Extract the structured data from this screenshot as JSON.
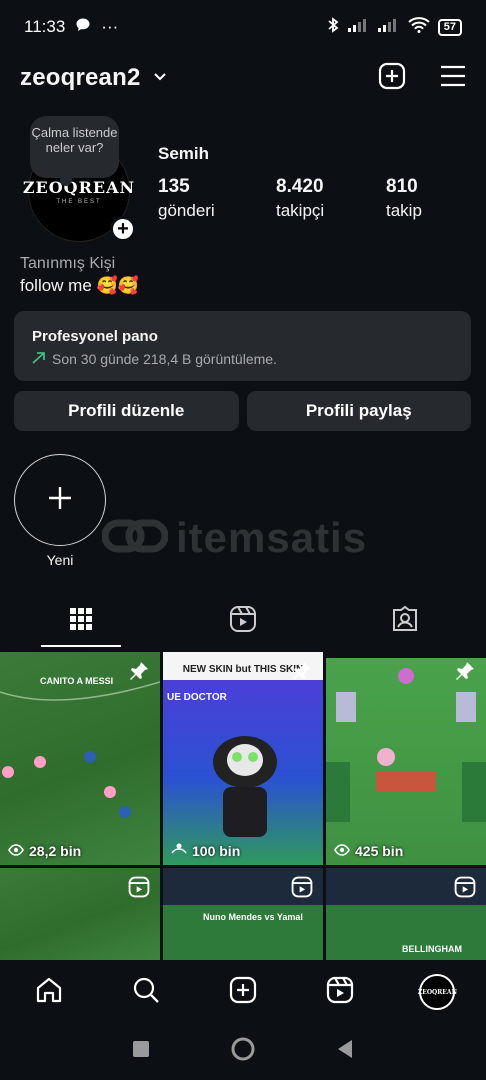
{
  "status_bar": {
    "time": "11:33",
    "dots": "···",
    "battery": "57"
  },
  "header": {
    "username": "zeoqrean2"
  },
  "profile": {
    "note": "Çalma listende neler var?",
    "avatar_logo": "ZEOQREAN",
    "avatar_sub": "THE BEST",
    "display_name": "Semih",
    "stats": [
      {
        "value": "135",
        "label": "gönderi"
      },
      {
        "value": "8.420",
        "label": "takipçi"
      },
      {
        "value": "810",
        "label": "takip"
      }
    ],
    "category": "Tanınmış Kişi",
    "bio": "follow me 🥰🥰"
  },
  "pro_panel": {
    "title": "Profesyonel pano",
    "subtitle": "Son 30 günde 218,4 B görüntüleme."
  },
  "buttons": {
    "edit": "Profili düzenle",
    "share": "Profili paylaş"
  },
  "highlight": {
    "label": "Yeni"
  },
  "watermark": {
    "text": "itemsatis"
  },
  "grid": {
    "tiles": [
      {
        "views": "28,2 bin",
        "caption": "CANITO A MESSI"
      },
      {
        "views": "100 bin",
        "caption": "NEW SKIN but THIS SKIN",
        "caption2": "UE DOCTOR"
      },
      {
        "views": "425 bin"
      },
      {
        "caption": ""
      },
      {
        "caption": "Nuno Mendes vs Yamal"
      },
      {
        "caption": "BELLINGHAM"
      }
    ]
  },
  "colors": {
    "background": "#0c1014",
    "panel": "#262a2f",
    "trend_green": "#3fbf7f"
  }
}
